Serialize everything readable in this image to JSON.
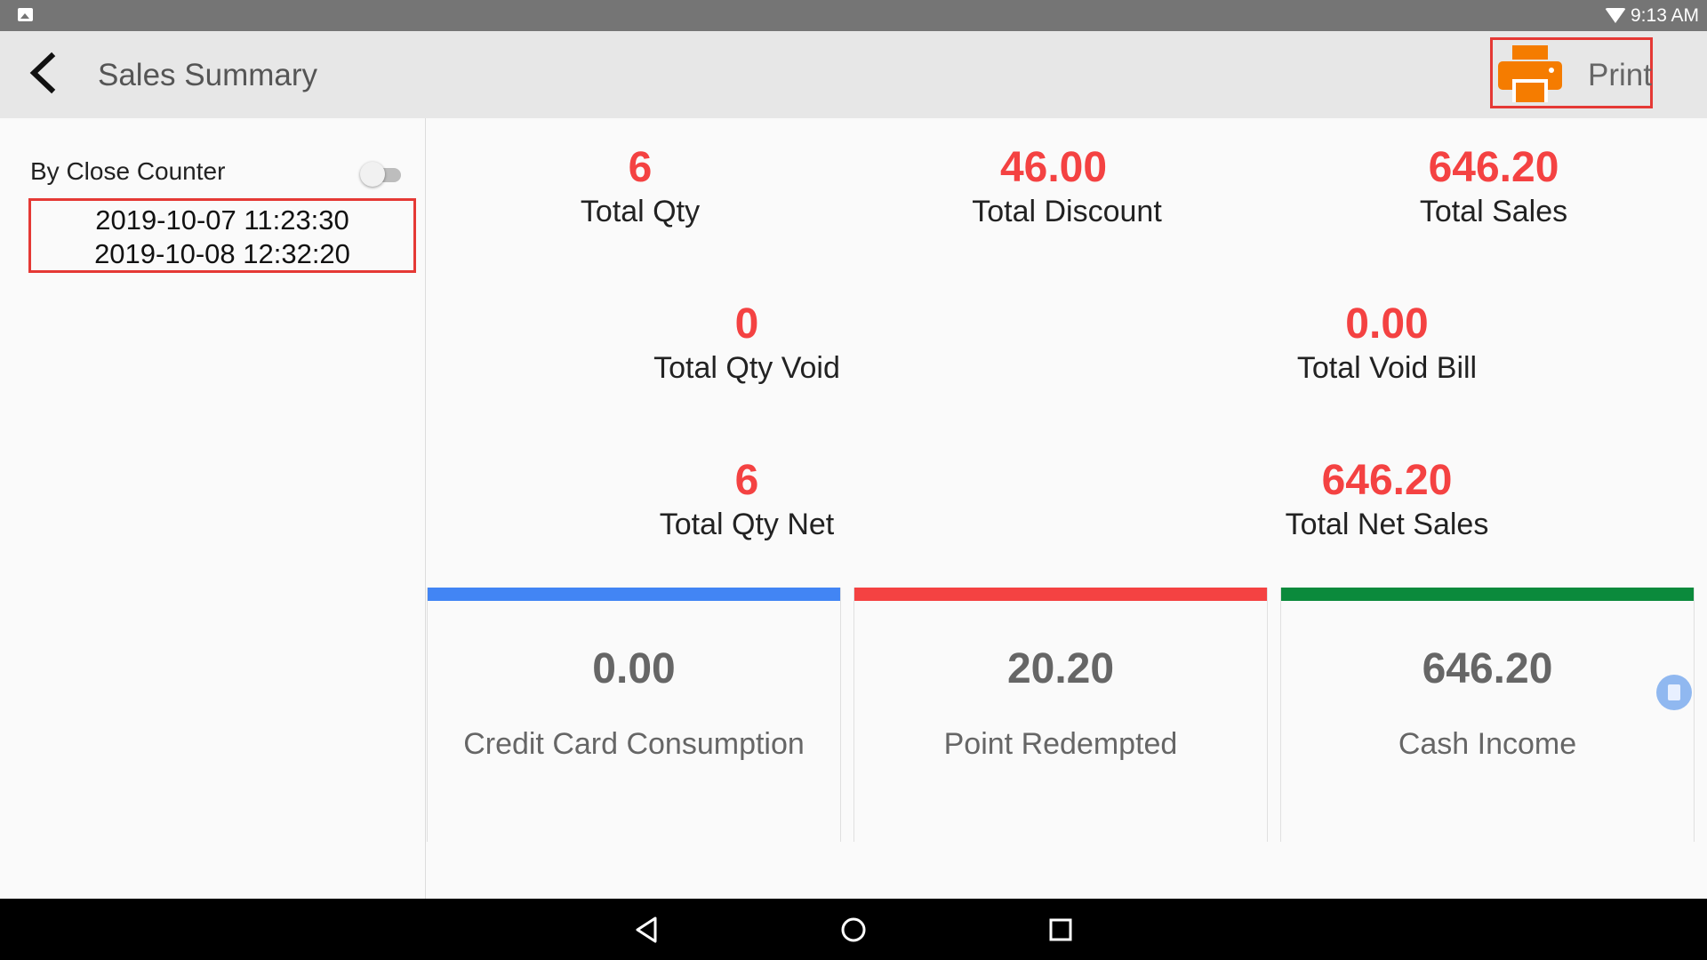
{
  "status_bar": {
    "time": "9:13 AM",
    "icons": [
      "gallery-icon",
      "wifi-icon"
    ]
  },
  "toolbar": {
    "title": "Sales Summary",
    "print_label": "Print",
    "print_icon_color": "#f57c00"
  },
  "sidebar": {
    "close_counter_label": "By Close Counter",
    "toggle_on": false,
    "date_from": "2019-10-07 11:23:30",
    "date_to": "2019-10-08 12:32:20"
  },
  "stats": {
    "total_qty": {
      "value": "6",
      "label": "Total Qty"
    },
    "total_discount": {
      "value": "46.00",
      "label": "Total Discount"
    },
    "total_sales": {
      "value": "646.20",
      "label": "Total Sales"
    },
    "total_qty_void": {
      "value": "0",
      "label": "Total Qty Void"
    },
    "total_void_bill": {
      "value": "0.00",
      "label": "Total Void Bill"
    },
    "total_qty_net": {
      "value": "6",
      "label": "Total Qty Net"
    },
    "total_net_sales": {
      "value": "646.20",
      "label": "Total Net Sales"
    }
  },
  "cards": {
    "credit_card": {
      "value": "0.00",
      "label": "Credit Card Consumption",
      "color": "#4285f4"
    },
    "point_redempted": {
      "value": "20.20",
      "label": "Point Redempted",
      "color": "#f44242"
    },
    "cash_income": {
      "value": "646.20",
      "label": "Cash Income",
      "color": "#0b8a3c"
    }
  },
  "colors": {
    "accent_red": "#f44242",
    "highlight_border": "#e53935"
  }
}
